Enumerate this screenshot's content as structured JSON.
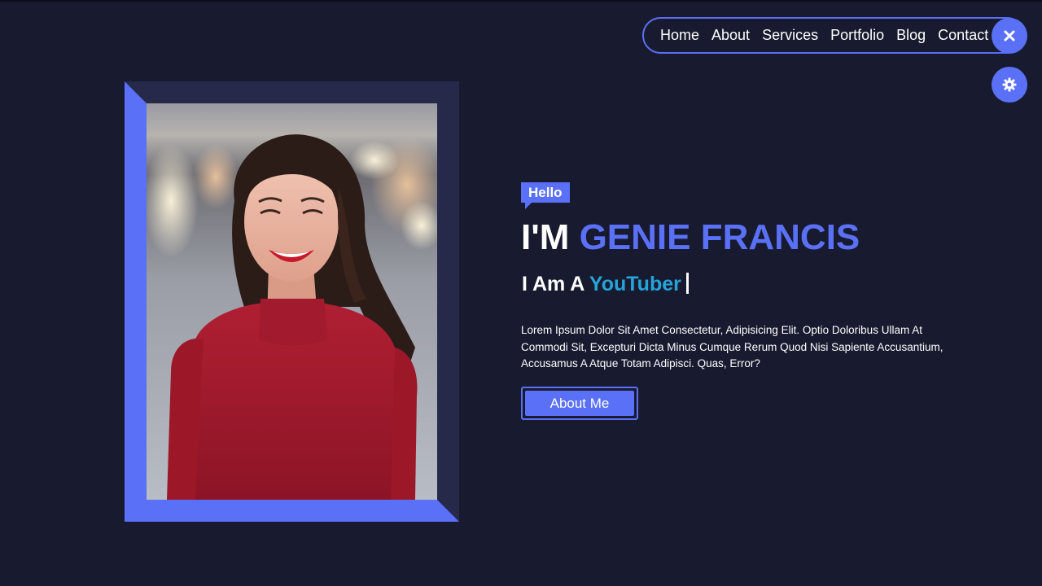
{
  "nav": {
    "items": [
      {
        "label": "Home"
      },
      {
        "label": "About"
      },
      {
        "label": "Services"
      },
      {
        "label": "Portfolio"
      },
      {
        "label": "Blog"
      },
      {
        "label": "Contact"
      }
    ],
    "close_icon": "close-icon",
    "theme_icon": "gear-icon"
  },
  "hero": {
    "badge": "Hello",
    "intro": "I'M",
    "name": "GENIE FRANCIS",
    "role_prefix": "I Am A",
    "role_typed": "YouTuber",
    "description": "Lorem Ipsum Dolor Sit Amet Consectetur, Adipisicing Elit. Optio Doloribus Ullam At Commodi Sit, Excepturi Dicta Minus Cumque Rerum Quod Nisi Sapiente Accusantium, Accusamus A Atque Totam Adipisci. Quas, Error?",
    "button_label": "About Me"
  },
  "colors": {
    "background": "#181a2f",
    "accent": "#5a71f7",
    "typed_text": "#26a3d9",
    "frame": "#26294a"
  }
}
